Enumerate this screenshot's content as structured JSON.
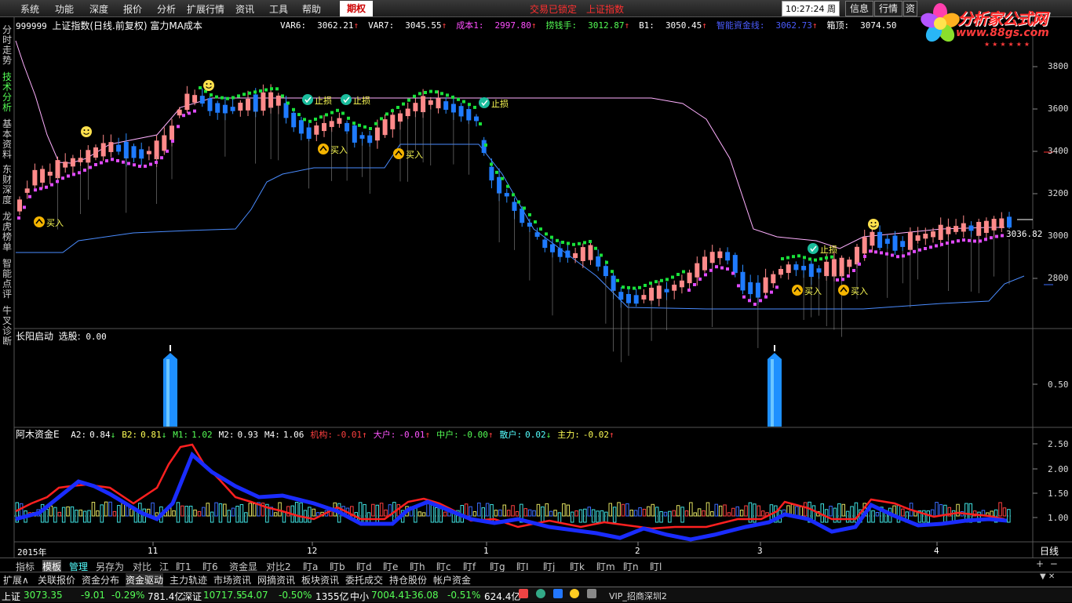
{
  "menu": {
    "items": [
      "系统",
      "功能",
      "深度",
      "报价",
      "分析",
      "扩展行情",
      "资讯",
      "工具",
      "帮助"
    ],
    "options_tab": "期权",
    "trade_locked": "交易已锁定",
    "index_name": "上证指数",
    "time": "10:27:24",
    "weekday": "周五",
    "info_btn": "信息",
    "quote_btn": "行情",
    "extra_btn": "资"
  },
  "logo": {
    "title": "分析家公式网",
    "url": "www.88gs.com",
    "stars": "★★★★★★"
  },
  "sidebar": [
    "分时走势",
    "技术分析",
    "基本资料",
    "东财深度",
    "龙虎榜单",
    "智能点评",
    "牛叉诊断"
  ],
  "main_panel": {
    "code": "999999",
    "header": "上证指数(日线.前复权) 富力MA成本",
    "indicators": [
      {
        "name": "VAR6:",
        "value": "3062.21",
        "arrow": "↑",
        "color": "#ffffff"
      },
      {
        "name": "VAR7:",
        "value": "3045.55",
        "arrow": "↑",
        "color": "#ffffff"
      },
      {
        "name": "成本1:",
        "value": "2997.80",
        "arrow": "↑",
        "color": "#ff4fff"
      },
      {
        "name": "捞钱手:",
        "value": "3012.87",
        "arrow": "↑",
        "color": "#55ff55"
      },
      {
        "name": "B1:",
        "value": "3050.45",
        "arrow": "↑",
        "color": "#ffffff"
      },
      {
        "name": "智能資金线:",
        "value": "3062.73",
        "arrow": "↑",
        "color": "#4b5cff"
      },
      {
        "name": "箱顶:",
        "value": "3074.50",
        "arrow": "",
        "color": "#ffffff"
      }
    ],
    "y_ticks": [
      "3800",
      "3600",
      "3400",
      "3200",
      "3000",
      "2800"
    ],
    "last_price": "3036.82",
    "signals": {
      "buy": "买入",
      "stop": "止损"
    }
  },
  "panel2": {
    "title": "长阳启动",
    "label": "选股:",
    "value": "0.00",
    "y_ticks": [
      "0.50"
    ]
  },
  "panel3": {
    "title": "阿木资金E",
    "items": [
      {
        "name": "A2:",
        "value": "0.84",
        "arrow": "↓",
        "color": "#ffffff"
      },
      {
        "name": "B2:",
        "value": "0.81",
        "arrow": "↓",
        "color": "#ffff55"
      },
      {
        "name": "M1:",
        "value": "1.02",
        "arrow": "",
        "color": "#55ff55"
      },
      {
        "name": "M2:",
        "value": "0.93",
        "arrow": "",
        "color": "#ffffff"
      },
      {
        "name": "M4:",
        "value": "1.06",
        "arrow": "",
        "color": "#ffffff"
      },
      {
        "name": "机构:",
        "value": "-0.01",
        "arrow": "↑",
        "color": "#ff4040"
      },
      {
        "name": "大户:",
        "value": "-0.01",
        "arrow": "↑",
        "color": "#ff55ff"
      },
      {
        "name": "中户:",
        "value": "-0.00",
        "arrow": "↑",
        "color": "#55ff55"
      },
      {
        "name": "散户:",
        "value": "0.02",
        "arrow": "↓",
        "color": "#55ffff"
      },
      {
        "name": "主力:",
        "value": "-0.02",
        "arrow": "↑",
        "color": "#ffff55"
      }
    ],
    "y_ticks": [
      "2.50",
      "2.00",
      "1.50",
      "1.00"
    ]
  },
  "time_axis": {
    "labels": [
      "2015年",
      "11",
      "12",
      "1",
      "2",
      "3",
      "4"
    ],
    "period": "日线"
  },
  "bottom_tabs": [
    "指标",
    "模板",
    "管理",
    "另存为",
    "对比",
    "江",
    "盯1",
    "盯6",
    "资金显",
    "对比2",
    "盯a",
    "盯b",
    "盯d",
    "盯e",
    "盯h",
    "盯c",
    "盯f",
    "盯g",
    "盯I",
    "盯j",
    "盯k",
    "盯m",
    "盯n",
    "盯l"
  ],
  "function_tabs": [
    "扩展∧",
    "关联报价",
    "资金分布",
    "资金驱动",
    "主力轨迹",
    "市场资讯",
    "网摘资讯",
    "板块资讯",
    "委托成交",
    "持仓股份",
    "帐户资金"
  ],
  "status": {
    "sh_name": "上证",
    "sh_price": "3073.35",
    "sh_chg": "-9.01",
    "sh_pct": "-0.29%",
    "sh_amt": "781.4亿",
    "sz_name": "深证",
    "sz_price": "10717.5",
    "sz_chg": "-54.07",
    "sz_pct": "-0.50%",
    "sz_amt": "1355亿",
    "zx_name": "中小",
    "zx_price": "7004.41",
    "zx_chg": "-36.08",
    "zx_pct": "-0.51%",
    "zx_amt": "624.4亿",
    "vip": "VIP_招商深圳2"
  }
}
